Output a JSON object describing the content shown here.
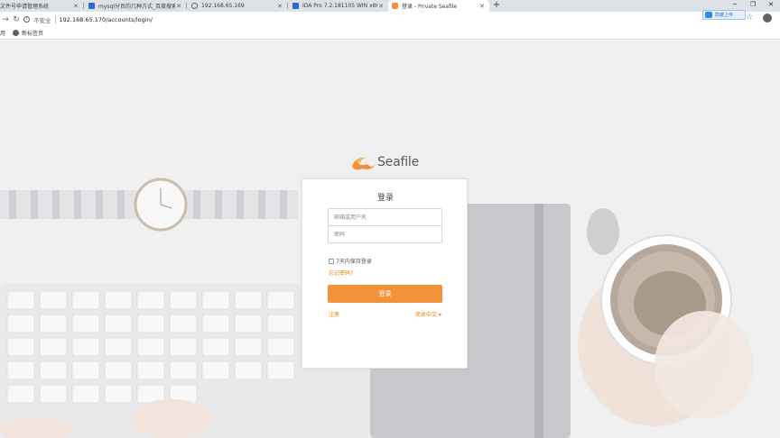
{
  "browser": {
    "tabs": [
      {
        "title": "文件号申请管理系统",
        "active": false
      },
      {
        "title": "mysql分页的几种方式_百度搜索",
        "active": false
      },
      {
        "title": "192.168.65.169",
        "active": false
      },
      {
        "title": "IDA Pro 7.2.181105 WIN x86/x",
        "active": false
      },
      {
        "title": "登录 - Private Seafile",
        "active": true
      }
    ],
    "new_tab_label": "+",
    "extension_button_label": "隐蔽上传",
    "security_label": "不安全",
    "url": "192.168.65.170/accounts/login/",
    "bookmarks": [
      {
        "label": "用"
      },
      {
        "label": "新标签页"
      }
    ]
  },
  "login": {
    "logo_text": "Seafile",
    "title": "登录",
    "username_placeholder": "邮箱或用户名",
    "password_placeholder": "密码",
    "remember_label": "7天内保持登录",
    "forgot_label": "忘记密码?",
    "submit_label": "登录",
    "signup_label": "注册",
    "language_label": "简体中文 ▾"
  },
  "colors": {
    "accent": "#f29339",
    "link": "#eb8205"
  }
}
